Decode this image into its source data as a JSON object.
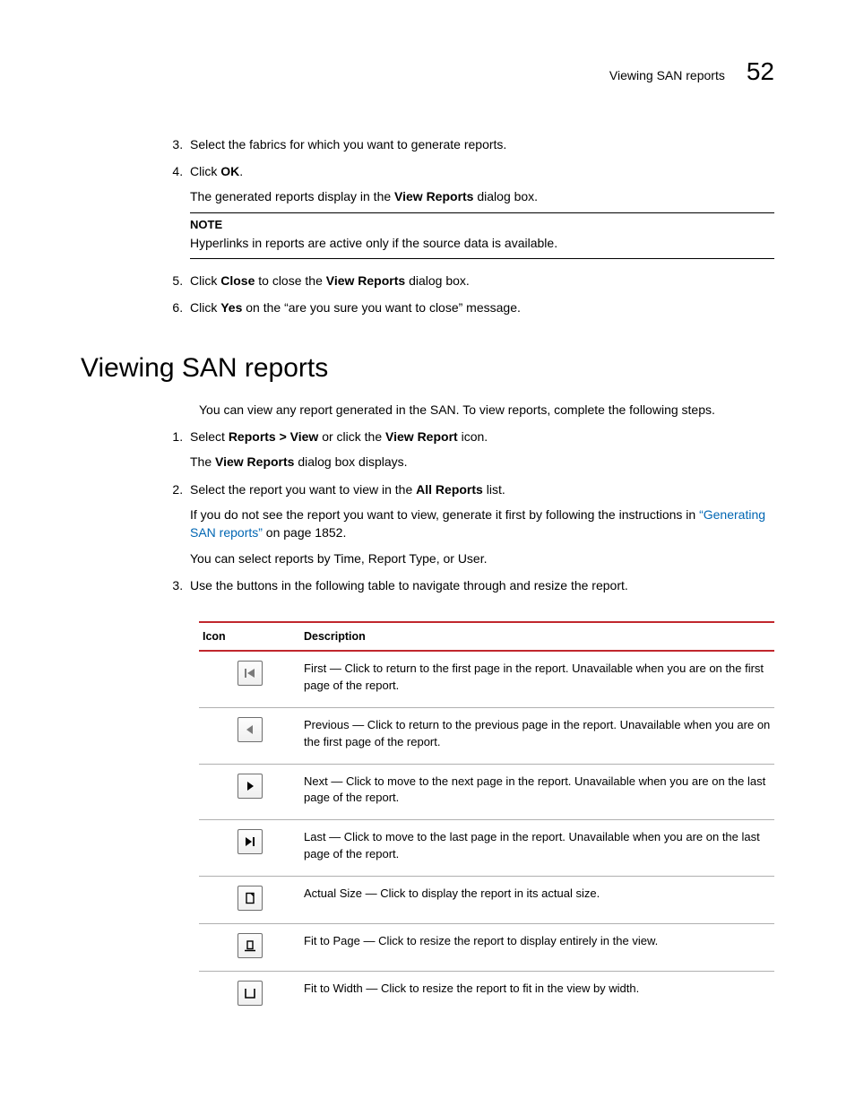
{
  "header": {
    "running_title": "Viewing SAN reports",
    "page_number": "52"
  },
  "top_steps": {
    "start": 3,
    "items": [
      {
        "text_before": "Select the fabrics for which you want to generate reports.",
        "subs": []
      },
      {
        "text_before": "Click ",
        "bold1": "OK",
        "text_after": ".",
        "subs": [
          {
            "frags": [
              {
                "t": "The generated reports display in the "
              },
              {
                "b": "View Reports"
              },
              {
                "t": " dialog box."
              }
            ]
          }
        ],
        "note": {
          "label": "NOTE",
          "text": "Hyperlinks in reports are active only if the source data is available."
        }
      },
      {
        "frags": [
          {
            "t": "Click "
          },
          {
            "b": "Close"
          },
          {
            "t": " to close the "
          },
          {
            "b": "View Reports"
          },
          {
            "t": " dialog box."
          }
        ]
      },
      {
        "frags": [
          {
            "t": "Click "
          },
          {
            "b": "Yes"
          },
          {
            "t": " on the “are you sure you want to close” message."
          }
        ]
      }
    ]
  },
  "section_heading": "Viewing SAN reports",
  "intro": "You can view any report generated in the SAN. To view reports, complete the following steps.",
  "view_steps": {
    "start": 1,
    "items": [
      {
        "frags": [
          {
            "t": "Select "
          },
          {
            "b": "Reports > View"
          },
          {
            "t": " or click the "
          },
          {
            "b": "View Report"
          },
          {
            "t": " icon."
          }
        ],
        "subs": [
          {
            "frags": [
              {
                "t": "The "
              },
              {
                "b": "View Reports"
              },
              {
                "t": " dialog box displays."
              }
            ]
          }
        ]
      },
      {
        "frags": [
          {
            "t": "Select the report you want to view in the "
          },
          {
            "b": "All Reports"
          },
          {
            "t": " list."
          }
        ],
        "subs": [
          {
            "frags": [
              {
                "t": "If you do not see the report you want to view, generate it first by following the instructions in "
              },
              {
                "link": "“Generating SAN reports”"
              },
              {
                "t": " on page 1852."
              }
            ]
          },
          {
            "frags": [
              {
                "t": "You can select reports by Time, Report Type, or User."
              }
            ]
          }
        ]
      },
      {
        "frags": [
          {
            "t": "Use the buttons in the following table to navigate through and resize the report."
          }
        ]
      }
    ]
  },
  "table": {
    "headers": {
      "icon": "Icon",
      "desc": "Description"
    },
    "rows": [
      {
        "icon": "first",
        "desc": "First — Click to return to the first page in the report. Unavailable when you are on the first page of the report."
      },
      {
        "icon": "prev",
        "desc": "Previous — Click to return to the previous page in the report. Unavailable when you are on the first page of the report."
      },
      {
        "icon": "next",
        "desc": "Next — Click to move to the next page in the report. Unavailable when you are on the last page of the report."
      },
      {
        "icon": "last",
        "desc": "Last — Click to move to the last page in the report. Unavailable when you are on the last page of the report."
      },
      {
        "icon": "actual",
        "desc": "Actual Size — Click to display the report in its actual size."
      },
      {
        "icon": "fitpage",
        "desc": "Fit to Page — Click to resize the report to display entirely in the view."
      },
      {
        "icon": "fitwidth",
        "desc": "Fit to Width — Click to resize the report to fit in the view by width."
      }
    ]
  }
}
